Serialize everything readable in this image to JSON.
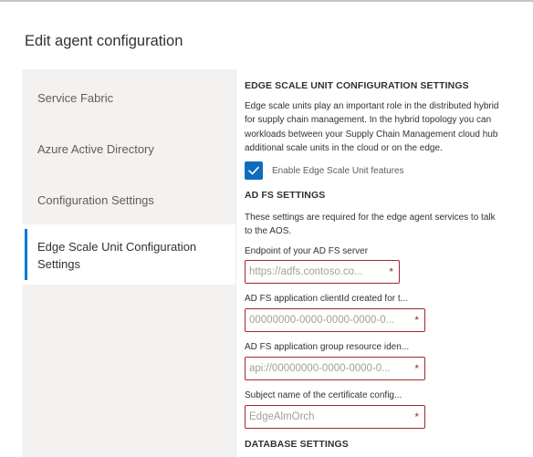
{
  "dialog": {
    "title": "Edit agent configuration"
  },
  "nav": {
    "items": [
      {
        "label": "Service Fabric",
        "active": false
      },
      {
        "label": "Azure Active Directory",
        "active": false
      },
      {
        "label": "Configuration Settings",
        "active": false
      },
      {
        "label_line1": "Edge Scale Unit Configuration",
        "label_line2": "Settings",
        "active": true
      }
    ]
  },
  "content": {
    "edge_section": {
      "heading": "EDGE SCALE UNIT CONFIGURATION SETTINGS",
      "description_lines": [
        "Edge scale units play an important role in the distributed hybrid",
        "for supply chain management. In the hybrid topology you can",
        "workloads between your Supply Chain Management cloud hub",
        "additional scale units in the cloud or on the edge."
      ],
      "checkbox_label": "Enable Edge Scale Unit features",
      "checkbox_checked": true
    },
    "adfs_section": {
      "heading": "AD FS SETTINGS",
      "description_lines": [
        "These settings are required for the edge agent services to talk",
        "to the AOS."
      ],
      "fields": [
        {
          "label": "Endpoint of your AD FS server",
          "placeholder": "https://adfs.contoso.co...",
          "required_mark": "*"
        },
        {
          "label": "AD FS application clientId created for t...",
          "placeholder": "00000000-0000-0000-0000-0...",
          "required_mark": "*"
        },
        {
          "label": "AD FS application group resource iden...",
          "placeholder": "api://00000000-0000-0000-0...",
          "required_mark": "*"
        },
        {
          "label": "Subject name of the certificate config...",
          "placeholder": "EdgeAlmOrch",
          "required_mark": "*"
        }
      ]
    },
    "database_section": {
      "heading": "DATABASE SETTINGS"
    }
  },
  "colors": {
    "accent": "#0078d4",
    "checkbox": "#0f6cbd",
    "error_border": "#a4262c",
    "nav_background": "#f3f2f1"
  }
}
